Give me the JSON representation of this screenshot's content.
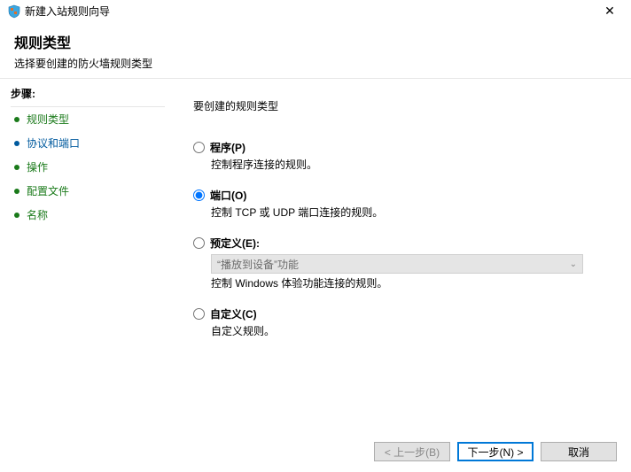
{
  "window": {
    "title": "新建入站规则向导",
    "close_glyph": "✕"
  },
  "header": {
    "title": "规则类型",
    "subtitle": "选择要创建的防火墙规则类型"
  },
  "sidebar": {
    "label": "步骤:",
    "items": [
      {
        "label": "规则类型"
      },
      {
        "label": "协议和端口"
      },
      {
        "label": "操作"
      },
      {
        "label": "配置文件"
      },
      {
        "label": "名称"
      }
    ]
  },
  "main": {
    "prompt": "要创建的规则类型",
    "options": {
      "program": {
        "label": "程序(P)",
        "desc": "控制程序连接的规则。"
      },
      "port": {
        "label": "端口(O)",
        "desc": "控制 TCP 或 UDP 端口连接的规则。"
      },
      "predef": {
        "label": "预定义(E):",
        "desc": "控制 Windows 体验功能连接的规则。",
        "select_value": "“播放到设备”功能",
        "caret": "⌄"
      },
      "custom": {
        "label": "自定义(C)",
        "desc": "自定义规则。"
      }
    }
  },
  "buttons": {
    "back": "< 上一步(B)",
    "next": "下一步(N) >",
    "cancel": "取消"
  }
}
